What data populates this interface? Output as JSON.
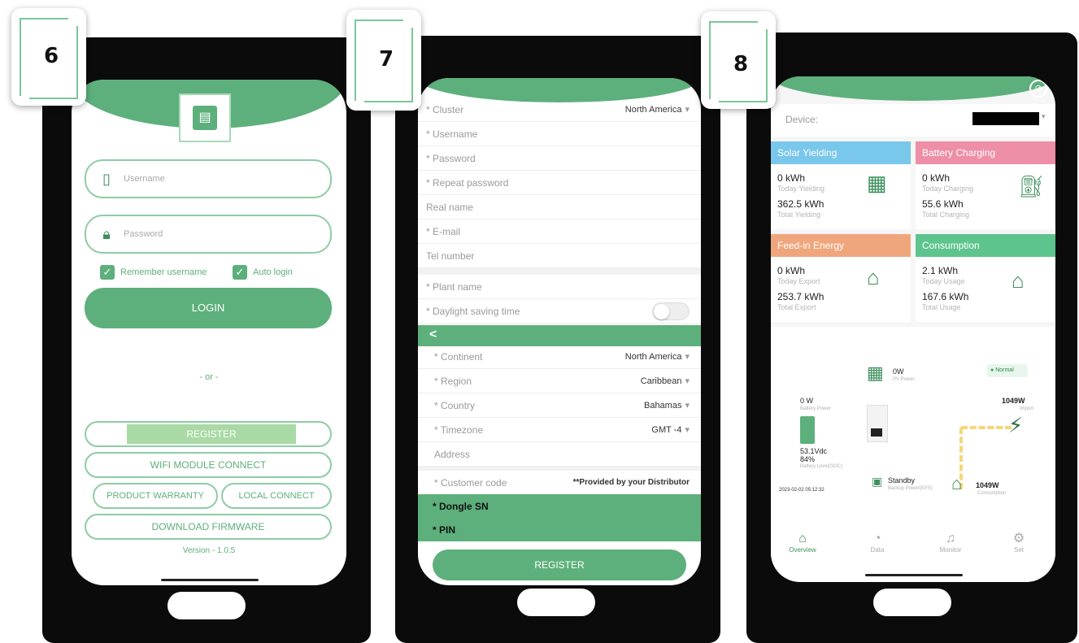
{
  "steps": [
    "6",
    "7",
    "8"
  ],
  "login": {
    "username_placeholder": "Username",
    "password_placeholder": "Password",
    "remember_label": "Remember username",
    "auto_login_label": "Auto login",
    "login_button": "LOGIN",
    "or_text": "- or -",
    "register_button": "REGISTER",
    "wifi_button": "WIFI MODULE CONNECT",
    "warranty_button": "PRODUCT WARRANTY",
    "local_button": "LOCAL CONNECT",
    "firmware_button": "DOWNLOAD FIRMWARE",
    "version": "Version - 1.0.5",
    "icons": {
      "username": "phone-icon",
      "password": "lock-icon",
      "check": "checkbox-icon",
      "logo": "battery-logo-icon"
    }
  },
  "register": {
    "fields": [
      {
        "label": "* Cluster",
        "value": "North America"
      },
      {
        "label": "* Username",
        "value": ""
      },
      {
        "label": "* Password",
        "value": ""
      },
      {
        "label": "* Repeat password",
        "value": ""
      },
      {
        "label": "Real name",
        "value": ""
      },
      {
        "label": "* E-mail",
        "value": ""
      },
      {
        "label": "Tel number",
        "value": ""
      }
    ],
    "plant_fields": [
      {
        "label": "* Plant name",
        "value": ""
      },
      {
        "label": "* Daylight saving time",
        "value": ""
      }
    ],
    "back_icon": "<",
    "location_fields": [
      {
        "label": "* Continent",
        "value": "North America"
      },
      {
        "label": "* Region",
        "value": "Caribbean"
      },
      {
        "label": "* Country",
        "value": "Bahamas"
      },
      {
        "label": "* Timezone",
        "value": "GMT -4"
      },
      {
        "label": "Address",
        "value": ""
      },
      {
        "label": "* Customer code",
        "value": "**Provided by your Distributor"
      }
    ],
    "dongle_label": "* Dongle SN",
    "pin_label": "* PIN",
    "register_button": "REGISTER",
    "caret": "▾"
  },
  "overview": {
    "device_label": "Device:",
    "tiles": [
      {
        "title": "Solar Yielding",
        "color": "#79c7ea",
        "today_value": "0 kWh",
        "today_label": "Today Yielding",
        "total_value": "362.5 kWh",
        "total_label": "Total Yielding",
        "icon": "solar-panel-icon"
      },
      {
        "title": "Battery Charging",
        "color": "#ee8fa7",
        "today_value": "0 kWh",
        "today_label": "Today Charging",
        "total_value": "55.6 kWh",
        "total_label": "Total Charging",
        "icon": "battery-charger-icon"
      },
      {
        "title": "Feed-in Energy",
        "color": "#f0a67c",
        "today_value": "0 kWh",
        "today_label": "Today Export",
        "total_value": "253.7 kWh",
        "total_label": "Total Export",
        "icon": "house-grid-icon"
      },
      {
        "title": "Consumption",
        "color": "#5ec48e",
        "today_value": "2.1 kWh",
        "today_label": "Today Usage",
        "total_value": "167.6 kWh",
        "total_label": "Total Usage",
        "icon": "house-bolt-icon"
      }
    ],
    "flow": {
      "pv_value": "0W",
      "pv_label": "PV Power",
      "status": "Normal",
      "battery_value": "0 W",
      "battery_label": "Battery Power",
      "grid_value": "1049W",
      "grid_label": "Import",
      "soc_voltage": "53.1Vdc",
      "soc_percent": "84%",
      "soc_label": "Battery Level(SOC)",
      "backup_value": "Standby",
      "backup_label": "Backup Power(EPS)",
      "consumption_value": "1049W",
      "consumption_label": "Consumption",
      "timestamp": "2023-02-02 05:12:32"
    },
    "nav": [
      {
        "label": "Overview",
        "icon": "home-icon",
        "active": true
      },
      {
        "label": "Data",
        "icon": "chart-icon",
        "active": false
      },
      {
        "label": "Monitor",
        "icon": "bell-icon",
        "active": false
      },
      {
        "label": "Set",
        "icon": "gear-icon",
        "active": false
      }
    ],
    "colors": {
      "accent": "#5db07c",
      "flow_line": "#f5d67a"
    }
  }
}
